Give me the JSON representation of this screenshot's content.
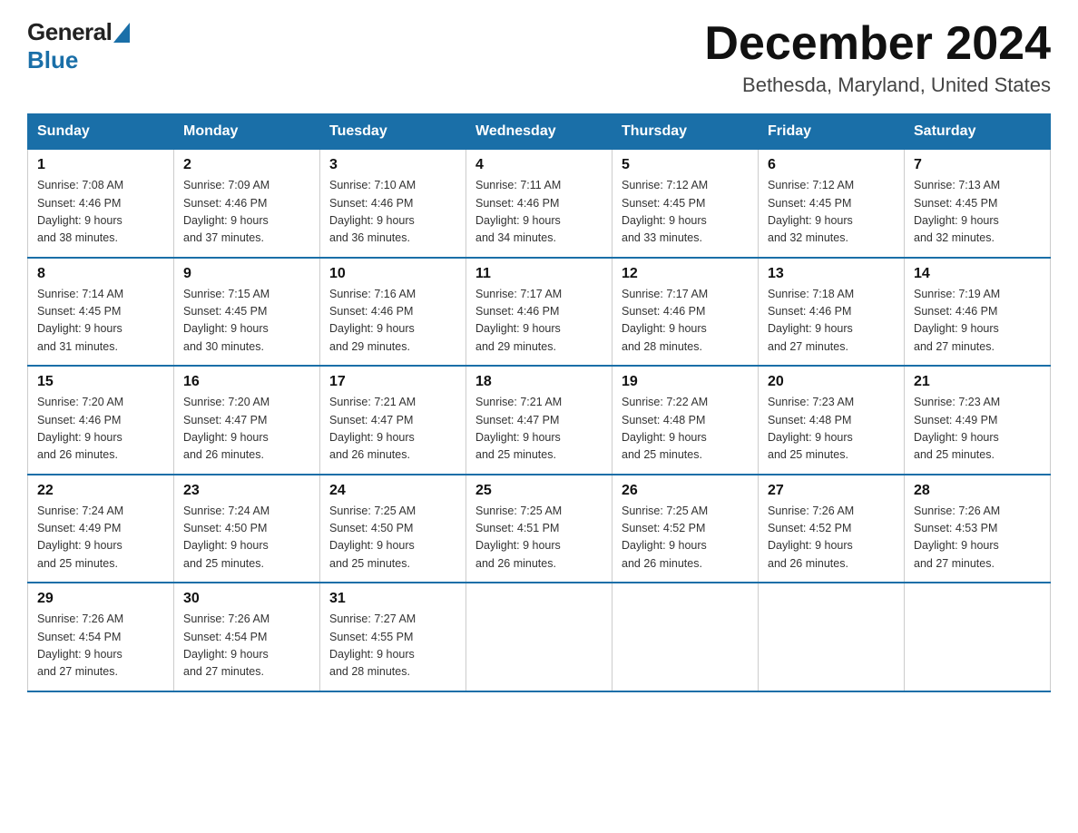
{
  "header": {
    "title": "December 2024",
    "subtitle": "Bethesda, Maryland, United States",
    "logo_general": "General",
    "logo_blue": "Blue"
  },
  "days_of_week": [
    "Sunday",
    "Monday",
    "Tuesday",
    "Wednesday",
    "Thursday",
    "Friday",
    "Saturday"
  ],
  "weeks": [
    [
      {
        "day": "1",
        "sunrise": "7:08 AM",
        "sunset": "4:46 PM",
        "daylight": "9 hours and 38 minutes."
      },
      {
        "day": "2",
        "sunrise": "7:09 AM",
        "sunset": "4:46 PM",
        "daylight": "9 hours and 37 minutes."
      },
      {
        "day": "3",
        "sunrise": "7:10 AM",
        "sunset": "4:46 PM",
        "daylight": "9 hours and 36 minutes."
      },
      {
        "day": "4",
        "sunrise": "7:11 AM",
        "sunset": "4:46 PM",
        "daylight": "9 hours and 34 minutes."
      },
      {
        "day": "5",
        "sunrise": "7:12 AM",
        "sunset": "4:45 PM",
        "daylight": "9 hours and 33 minutes."
      },
      {
        "day": "6",
        "sunrise": "7:12 AM",
        "sunset": "4:45 PM",
        "daylight": "9 hours and 32 minutes."
      },
      {
        "day": "7",
        "sunrise": "7:13 AM",
        "sunset": "4:45 PM",
        "daylight": "9 hours and 32 minutes."
      }
    ],
    [
      {
        "day": "8",
        "sunrise": "7:14 AM",
        "sunset": "4:45 PM",
        "daylight": "9 hours and 31 minutes."
      },
      {
        "day": "9",
        "sunrise": "7:15 AM",
        "sunset": "4:45 PM",
        "daylight": "9 hours and 30 minutes."
      },
      {
        "day": "10",
        "sunrise": "7:16 AM",
        "sunset": "4:46 PM",
        "daylight": "9 hours and 29 minutes."
      },
      {
        "day": "11",
        "sunrise": "7:17 AM",
        "sunset": "4:46 PM",
        "daylight": "9 hours and 29 minutes."
      },
      {
        "day": "12",
        "sunrise": "7:17 AM",
        "sunset": "4:46 PM",
        "daylight": "9 hours and 28 minutes."
      },
      {
        "day": "13",
        "sunrise": "7:18 AM",
        "sunset": "4:46 PM",
        "daylight": "9 hours and 27 minutes."
      },
      {
        "day": "14",
        "sunrise": "7:19 AM",
        "sunset": "4:46 PM",
        "daylight": "9 hours and 27 minutes."
      }
    ],
    [
      {
        "day": "15",
        "sunrise": "7:20 AM",
        "sunset": "4:46 PM",
        "daylight": "9 hours and 26 minutes."
      },
      {
        "day": "16",
        "sunrise": "7:20 AM",
        "sunset": "4:47 PM",
        "daylight": "9 hours and 26 minutes."
      },
      {
        "day": "17",
        "sunrise": "7:21 AM",
        "sunset": "4:47 PM",
        "daylight": "9 hours and 26 minutes."
      },
      {
        "day": "18",
        "sunrise": "7:21 AM",
        "sunset": "4:47 PM",
        "daylight": "9 hours and 25 minutes."
      },
      {
        "day": "19",
        "sunrise": "7:22 AM",
        "sunset": "4:48 PM",
        "daylight": "9 hours and 25 minutes."
      },
      {
        "day": "20",
        "sunrise": "7:23 AM",
        "sunset": "4:48 PM",
        "daylight": "9 hours and 25 minutes."
      },
      {
        "day": "21",
        "sunrise": "7:23 AM",
        "sunset": "4:49 PM",
        "daylight": "9 hours and 25 minutes."
      }
    ],
    [
      {
        "day": "22",
        "sunrise": "7:24 AM",
        "sunset": "4:49 PM",
        "daylight": "9 hours and 25 minutes."
      },
      {
        "day": "23",
        "sunrise": "7:24 AM",
        "sunset": "4:50 PM",
        "daylight": "9 hours and 25 minutes."
      },
      {
        "day": "24",
        "sunrise": "7:25 AM",
        "sunset": "4:50 PM",
        "daylight": "9 hours and 25 minutes."
      },
      {
        "day": "25",
        "sunrise": "7:25 AM",
        "sunset": "4:51 PM",
        "daylight": "9 hours and 26 minutes."
      },
      {
        "day": "26",
        "sunrise": "7:25 AM",
        "sunset": "4:52 PM",
        "daylight": "9 hours and 26 minutes."
      },
      {
        "day": "27",
        "sunrise": "7:26 AM",
        "sunset": "4:52 PM",
        "daylight": "9 hours and 26 minutes."
      },
      {
        "day": "28",
        "sunrise": "7:26 AM",
        "sunset": "4:53 PM",
        "daylight": "9 hours and 27 minutes."
      }
    ],
    [
      {
        "day": "29",
        "sunrise": "7:26 AM",
        "sunset": "4:54 PM",
        "daylight": "9 hours and 27 minutes."
      },
      {
        "day": "30",
        "sunrise": "7:26 AM",
        "sunset": "4:54 PM",
        "daylight": "9 hours and 27 minutes."
      },
      {
        "day": "31",
        "sunrise": "7:27 AM",
        "sunset": "4:55 PM",
        "daylight": "9 hours and 28 minutes."
      },
      null,
      null,
      null,
      null
    ]
  ],
  "labels": {
    "sunrise": "Sunrise:",
    "sunset": "Sunset:",
    "daylight": "Daylight:"
  }
}
